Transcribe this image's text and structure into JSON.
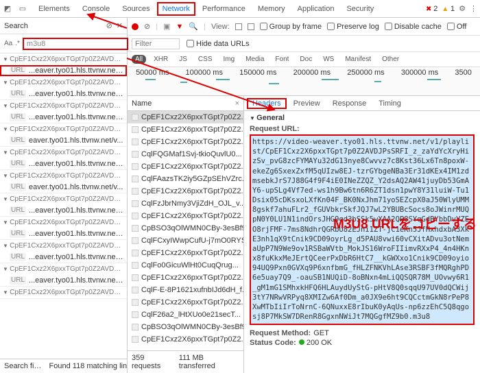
{
  "toolbar": {
    "tabs": [
      "Elements",
      "Console",
      "Sources",
      "Network",
      "Performance",
      "Memory",
      "Application",
      "Security"
    ],
    "active": "Network",
    "errors": "2",
    "warnings": "1"
  },
  "search": {
    "title": "Search",
    "aa": "Aa",
    "regex": ".*",
    "value": "m3u8",
    "groups": [
      {
        "file": "CpEF1Cxz2X6pxxTGpt7p0Z2AVDJP...",
        "path": "...eaver.tyo01.hls.ttvnw.net/v...",
        "boxed": true
      },
      {
        "file": "CpEF1Cxz2X6pxxTGpt7p0Z2AVDJP...",
        "path": "...eaver.tyo01.hls.ttvnw.net/v..."
      },
      {
        "file": "CpEF1Cxz2X6pxxTGpt7p0Z2AVDJP...",
        "path": "...eaver.tyo01.hls.ttvnw.net/v..."
      },
      {
        "file": "CpEF1Cxz2X6pxxTGpt7p0Z2AVDJP...",
        "path": "eaver.tyo01.hls.ttvnw.net/v..."
      },
      {
        "file": "CpEF1Cxz2X6pxxTGpt7p0Z2AVDJP...",
        "path": "...eaver.tyo01.hls.ttvnw.net/v..."
      },
      {
        "file": "CpEF1Cxz2X6pxxTGpt7p0Z2AVDJP...",
        "path": "eaver.tyo01.hls.ttvnw.net/v..."
      },
      {
        "file": "CpEF1Cxz2X6pxxTGpt7p0Z2AVDJP...",
        "path": "...eaver.tyo01.hls.ttvnw.net/v..."
      },
      {
        "file": "CpEF1Cxz2X6pxxTGpt7p0Z2AVDJP...",
        "path": "...eaver.tyo01.hls.ttvnw.net/v..."
      },
      {
        "file": "CpEF1Cxz2X6pxxTGpt7p0Z2AVDJP...",
        "path": "...eaver.tyo01.hls.ttvnw.net/v..."
      },
      {
        "file": "CpEF1Cxz2X6pxxTGpt7p0Z2AVDJP...",
        "path": "...eaver.tyo01.hls.ttvnw.net/v..."
      },
      {
        "file": "CpEF1Cxz2X6pxxTGpt7p0Z2AVDJP...",
        "path": ""
      }
    ],
    "footer_left": "Search fi…",
    "footer_right": "Found 118 matching line…"
  },
  "filters": {
    "view": "View:",
    "group": "Group by frame",
    "preserve": "Preserve log",
    "disable": "Disable cache",
    "off": "Off",
    "filter_placeholder": "Filter",
    "hide": "Hide data URLs",
    "types": [
      "All",
      "XHR",
      "JS",
      "CSS",
      "Img",
      "Media",
      "Font",
      "Doc",
      "WS",
      "Manifest",
      "Other"
    ]
  },
  "timeline": {
    "ticks": [
      "50000 ms",
      "100000 ms",
      "150000 ms",
      "200000 ms",
      "250000 ms",
      "300000 ms",
      "3500"
    ]
  },
  "req_col": {
    "header": "Name",
    "items": [
      "CpEF1Cxz2X6pxxTGpt7p0Z2...",
      "CpEF1Cxz2X6pxxTGpt7p0Z2...",
      "CpEF1Cxz2X6pxxTGpt7p0Z2...",
      "CqlFQGMaf1Svj-tkioQuvlU0...",
      "CpEF1Cxz2X6pxxTGpt7p0Z2...",
      "CqlFAazsTK2iy5GZpSEhVZrc...",
      "CpEF1Cxz2X6pxxTGpt7p0Z2...",
      "CqlFzJbrNmy3VjiZdH_OJL_v...",
      "CpEF1Cxz2X6pxxTGpt7p0Z2...",
      "CpBSO3qOlWMN0CBy-3esBf9...",
      "CqlFCxyIWwpCufU-j7mO0RYS...",
      "CpEF1Cxz2X6pxxTGpt7p0Z2...",
      "CqlFo0GicuWlHt0CuqQrug...",
      "CpEF1Cxz2X6pxxTGpt7p0Z2...",
      "CqlF-E-8P1621xufnbIJd6dH_f...",
      "CpEF1Cxz2X6pxxTGpt7p0Z2...",
      "CqlF26a2_lHtXUo0e21secT...",
      "CpBSO3qOlWMN0CBy-3esBf9...",
      "CpEF1Cxz2X6pxxTGpt7p0Z2..."
    ],
    "footer_left": "359 requests",
    "footer_right": "111 MB transferred"
  },
  "detail": {
    "tabs": [
      "Headers",
      "Preview",
      "Response",
      "Timing"
    ],
    "general": "General",
    "request_url_label": "Request URL:",
    "request_url": "https://video-weaver.tyo01.hls.ttvnw.net/v1/playlist/CpEF1Cxz2X6pxxTGpt7p0Z2AVDJPsSRFI_z_zaYdYcXryHizSv_pvG8zcFYMAYu32dG13nye8Cwvvz7c8Kst36Lx6Tn8poxW-ekeZg6SxexZxfM5qUIzw8EJ-tzrGYbgeNBa3Er31dKEx4IM1zdmsebkJrS7J88G4f9F4iE0INeZZQZ_Y2dsAQ2AW41juyDb53GmAY6-upSLg4Vf7ed-ws1h9Bw6tn6R6ZT1dsn1pwY8Y31luiW-Tu1Dsix05cDKsxoLXfKn04F_BK0NxJhm71yoSEZcpX0aJ50WlyUMM8gskf7ahuFLr2_fGUVbkrSkfJQJ7wL2YBUBcSocs8oJWinrMUQpN0Y0LU1N1indOrsJHG9qd3bSSk5wXAA2QP8SYqGdBYbbDvVZEO8rjFMF-7ms8NdhrQGRbU82EJni1ZT-jC1eKn5JfHxhdxbA3XkE3nh1qX9tCnik9CD09oyrLg_d5PAU8vwi60vCXitADvu3otNemaUpP7N9We9ov1RSBaWVtb_MokJS16WroFIIimvRXxP4_4n4HKnx8fuKkxMeJErtQCeerPxDbR6HtC7__kGWXxo1Cnik9CD09oyio94UQ9Pxn0GVXq9P6xnfbmG_fHLZFNKVhLAse3RSBF3fMQRghPD6e5uay7Q9_-oauSB1NUQiD-8oBNxn4mLiQQSQR78M_UOvwy6R1_gM1mG1SMhxkHFQ6HLAuydUyStG-pHtV8Q0sqqU97UV0dQCWij3tY7NRwVRPyq8XMIZw6Af0Dm_a0JX9e6ht9CQCctmGkN8rPeP8XwMTbIiIrToNrnC-6QNuxxE8rIbuK0yAqUs-np6zzEhC5Q8qgosj8P7MkSW7DRenR8GgxnNWiJt7MQGgfMZ9b0.m3u8",
    "request_method_label": "Request Method:",
    "request_method": "GET",
    "status_label": "Status Code:",
    "status_code": "200  OK"
  },
  "annotation": "M3U8 URLをコピーする"
}
